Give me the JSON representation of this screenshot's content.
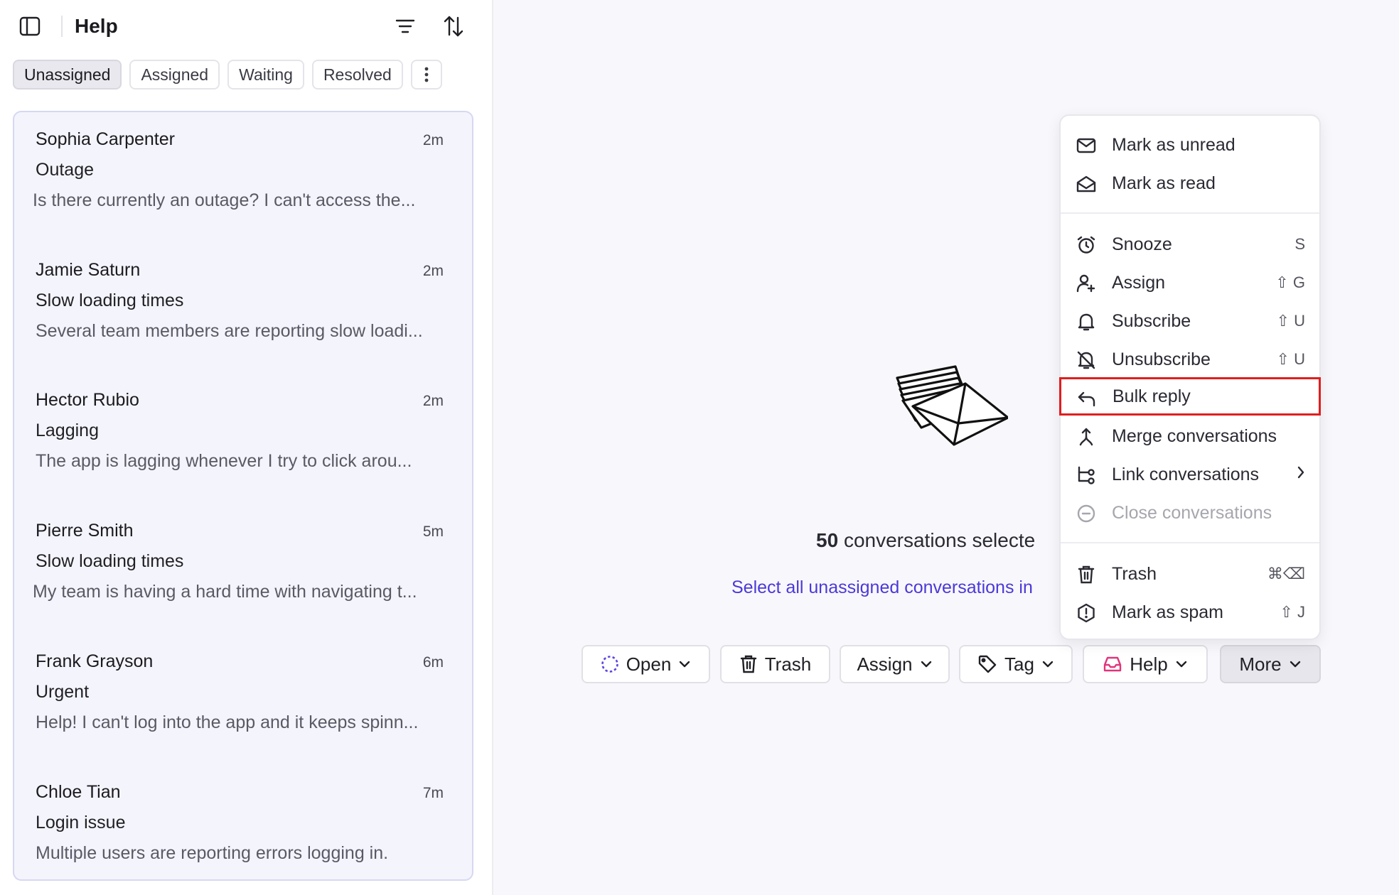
{
  "header": {
    "title": "Help"
  },
  "tabs": [
    {
      "label": "Unassigned",
      "active": true
    },
    {
      "label": "Assigned",
      "active": false
    },
    {
      "label": "Waiting",
      "active": false
    },
    {
      "label": "Resolved",
      "active": false
    }
  ],
  "conversations": [
    {
      "name": "Sophia Carpenter",
      "time": "2m",
      "subject": "Outage",
      "preview": "Is there currently an outage? I can't access the..."
    },
    {
      "name": "Jamie Saturn",
      "time": "2m",
      "subject": "Slow loading times",
      "preview": "Several team members are reporting slow loadi..."
    },
    {
      "name": "Hector Rubio",
      "time": "2m",
      "subject": "Lagging",
      "preview": "The app is lagging whenever I try to click arou..."
    },
    {
      "name": "Pierre Smith",
      "time": "5m",
      "subject": "Slow loading times",
      "preview": "My team is having a hard time with navigating t..."
    },
    {
      "name": "Frank Grayson",
      "time": "6m",
      "subject": "Urgent",
      "preview": "Help! I can't log into the app and it keeps spinn..."
    },
    {
      "name": "Chloe Tian",
      "time": "7m",
      "subject": "Login issue",
      "preview": "Multiple users are reporting errors logging in."
    }
  ],
  "main": {
    "count": "50",
    "count_suffix": "conversations selecte",
    "select_all": "Select all unassigned conversations in"
  },
  "bulk_actions": {
    "open": "Open",
    "trash": "Trash",
    "assign": "Assign",
    "tag": "Tag",
    "help": "Help",
    "more": "More"
  },
  "menu": {
    "mark_unread": {
      "label": "Mark as unread"
    },
    "mark_read": {
      "label": "Mark as read"
    },
    "snooze": {
      "label": "Snooze",
      "shortcut": "S"
    },
    "assign": {
      "label": "Assign",
      "shortcut": "⇧ G"
    },
    "subscribe": {
      "label": "Subscribe",
      "shortcut": "⇧ U"
    },
    "unsubscribe": {
      "label": "Unsubscribe",
      "shortcut": "⇧ U"
    },
    "bulk_reply": {
      "label": "Bulk reply"
    },
    "merge": {
      "label": "Merge conversations"
    },
    "link": {
      "label": "Link conversations"
    },
    "close": {
      "label": "Close conversations"
    },
    "trash": {
      "label": "Trash",
      "shortcut": "⌘⌫"
    },
    "spam": {
      "label": "Mark as spam",
      "shortcut": "⇧ J"
    }
  },
  "colors": {
    "accent": "#4b39d8",
    "help_icon": "#e0357a",
    "highlight": "#e01e1e"
  }
}
